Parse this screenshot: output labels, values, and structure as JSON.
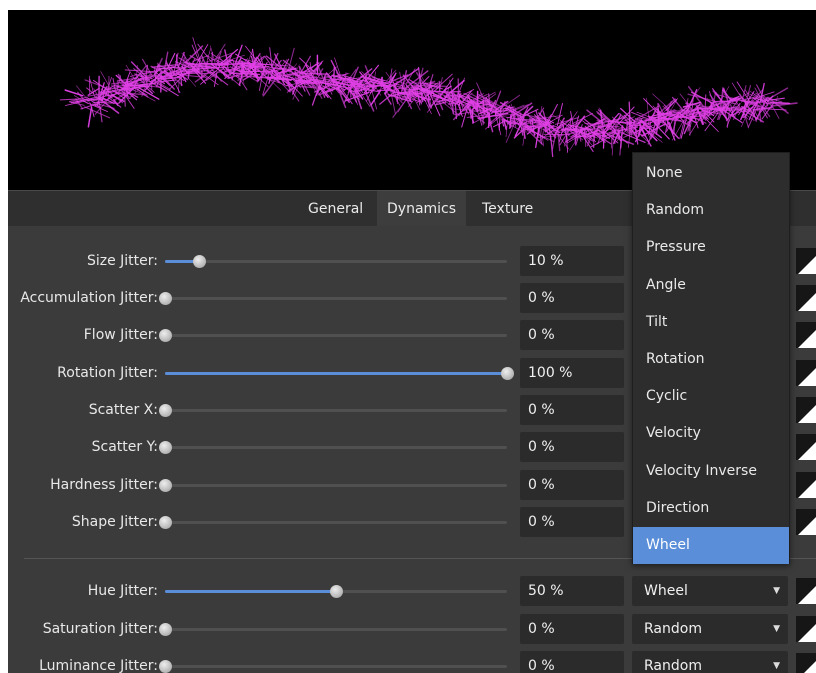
{
  "tabs": [
    {
      "label": "General"
    },
    {
      "label": "Dynamics"
    },
    {
      "label": "Texture"
    }
  ],
  "active_tab": "Dynamics",
  "colors": {
    "accent": "#5b8ed8",
    "stroke_preview": "#e040e6",
    "panel_bg": "#3b3b3b",
    "field_bg": "#2b2b2b"
  },
  "jitter_rows": [
    {
      "label": "Size Jitter:",
      "value": "10 %",
      "fraction": 0.1
    },
    {
      "label": "Accumulation Jitter:",
      "value": "0 %",
      "fraction": 0
    },
    {
      "label": "Flow Jitter:",
      "value": "0 %",
      "fraction": 0
    },
    {
      "label": "Rotation Jitter:",
      "value": "100 %",
      "fraction": 1
    },
    {
      "label": "Scatter X:",
      "value": "0 %",
      "fraction": 0
    },
    {
      "label": "Scatter Y:",
      "value": "0 %",
      "fraction": 0
    },
    {
      "label": "Hardness Jitter:",
      "value": "0 %",
      "fraction": 0
    },
    {
      "label": "Shape Jitter:",
      "value": "0 %",
      "fraction": 0
    }
  ],
  "color_rows": [
    {
      "label": "Hue Jitter:",
      "value": "50 %",
      "fraction": 0.5,
      "controller": "Wheel"
    },
    {
      "label": "Saturation Jitter:",
      "value": "0 %",
      "fraction": 0,
      "controller": "Random"
    },
    {
      "label": "Luminance Jitter:",
      "value": "0 %",
      "fraction": 0,
      "controller": "Random"
    }
  ],
  "dropdown": {
    "options": [
      "None",
      "Random",
      "Pressure",
      "Angle",
      "Tilt",
      "Rotation",
      "Cyclic",
      "Velocity",
      "Velocity Inverse",
      "Direction",
      "Wheel"
    ],
    "selected": "Wheel"
  }
}
